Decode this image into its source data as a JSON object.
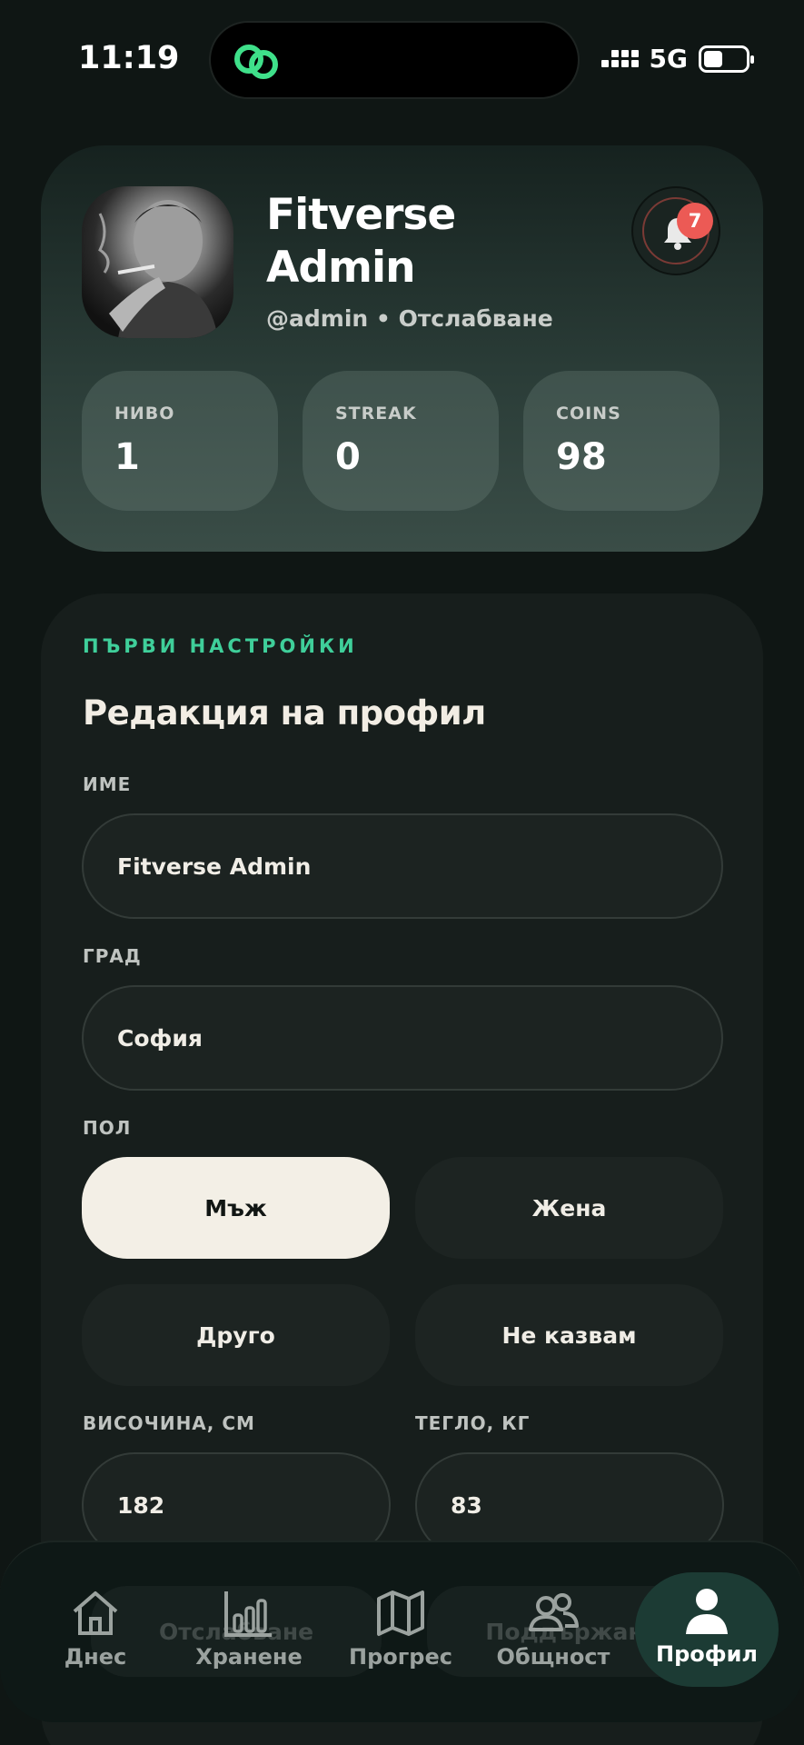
{
  "status_bar": {
    "time": "11:19",
    "network": "5G"
  },
  "profile": {
    "name": "Fitverse Admin",
    "subtitle": "@admin • Отслабване",
    "notifications_count": "7",
    "stats": [
      {
        "label": "НИВО",
        "value": "1"
      },
      {
        "label": "STREAK",
        "value": "0"
      },
      {
        "label": "COINS",
        "value": "98"
      }
    ]
  },
  "settings": {
    "eyebrow": "ПЪРВИ НАСТРОЙКИ",
    "title": "Редакция на профил",
    "name_label": "ИМЕ",
    "name_value": "Fitverse Admin",
    "city_label": "ГРАД",
    "city_value": "София",
    "gender_label": "ПОЛ",
    "gender_options": [
      "Мъж",
      "Жена",
      "Друго",
      "Не казвам"
    ],
    "gender_selected": "Мъж",
    "height_label": "ВИСОЧИНА, СМ",
    "height_value": "182",
    "weight_label": "ТЕГЛО, КГ",
    "weight_value": "83",
    "obscured_buttons": [
      "Отслабване",
      "Поддържане"
    ]
  },
  "nav": {
    "items": [
      {
        "label": "Днес",
        "icon": "home-icon"
      },
      {
        "label": "Хранене",
        "icon": "bar-chart-icon"
      },
      {
        "label": "Прогрес",
        "icon": "map-icon"
      },
      {
        "label": "Общност",
        "icon": "people-icon"
      },
      {
        "label": "Профил",
        "icon": "person-icon"
      }
    ],
    "active": "Профил"
  },
  "colors": {
    "accent_green": "#3fcf9a",
    "badge_red": "#ec5a55",
    "active_chip": "#f3efe6",
    "nav_active_bg": "#1c3b34"
  }
}
